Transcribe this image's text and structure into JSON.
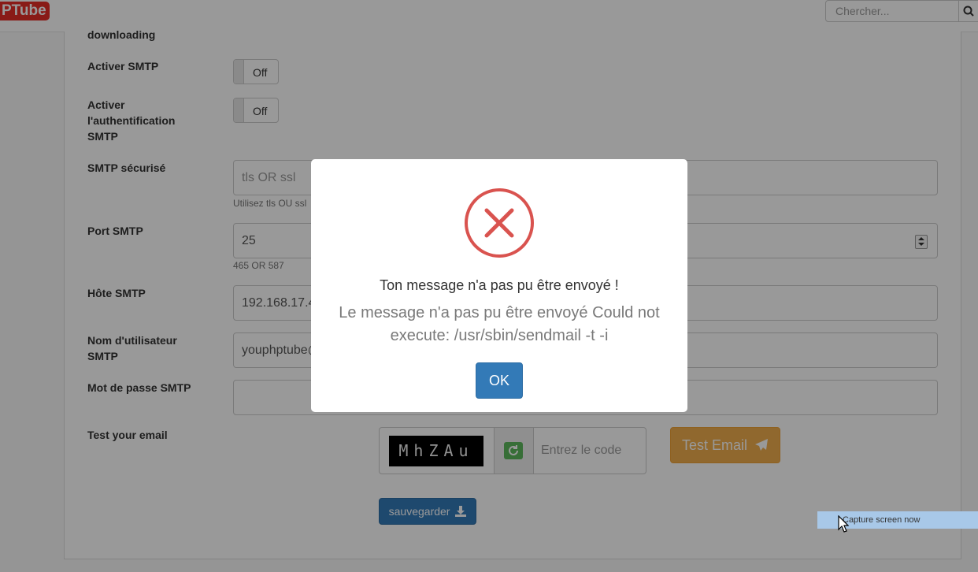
{
  "navbar": {
    "logo": "PTube",
    "search_placeholder": "Chercher..."
  },
  "form": {
    "partial_label": "downloading",
    "smtp_enable": {
      "label": "Activer SMTP",
      "value": "Off"
    },
    "smtp_auth": {
      "label": "Activer l'authentification SMTP",
      "value": "Off"
    },
    "smtp_secure": {
      "label": "SMTP sécurisé",
      "placeholder": "tls OR ssl",
      "help": "Utilisez tls OU ssl"
    },
    "smtp_port": {
      "label": "Port SMTP",
      "value": "25",
      "help": "465 OR 587"
    },
    "smtp_host": {
      "label": "Hôte SMTP",
      "value": "192.168.17.4"
    },
    "smtp_user": {
      "label": "Nom d'utilisateur SMTP",
      "value": "youphptube@"
    },
    "smtp_password": {
      "label": "Mot de passe SMTP",
      "value": ""
    },
    "test_email": {
      "label": "Test your email",
      "captcha_text": "MhZAu",
      "code_placeholder": "Entrez le code",
      "button": "Test Email"
    },
    "save_button": "sauvegarder"
  },
  "modal": {
    "title": "Ton message n'a pas pu être envoyé !",
    "text": "Le message n'a pas pu être envoyé Could not execute: /usr/sbin/sendmail -t -i",
    "ok": "OK",
    "icon": "error-x-icon",
    "accent_color": "#d9534f"
  },
  "capture_tooltip": "Capture screen now"
}
